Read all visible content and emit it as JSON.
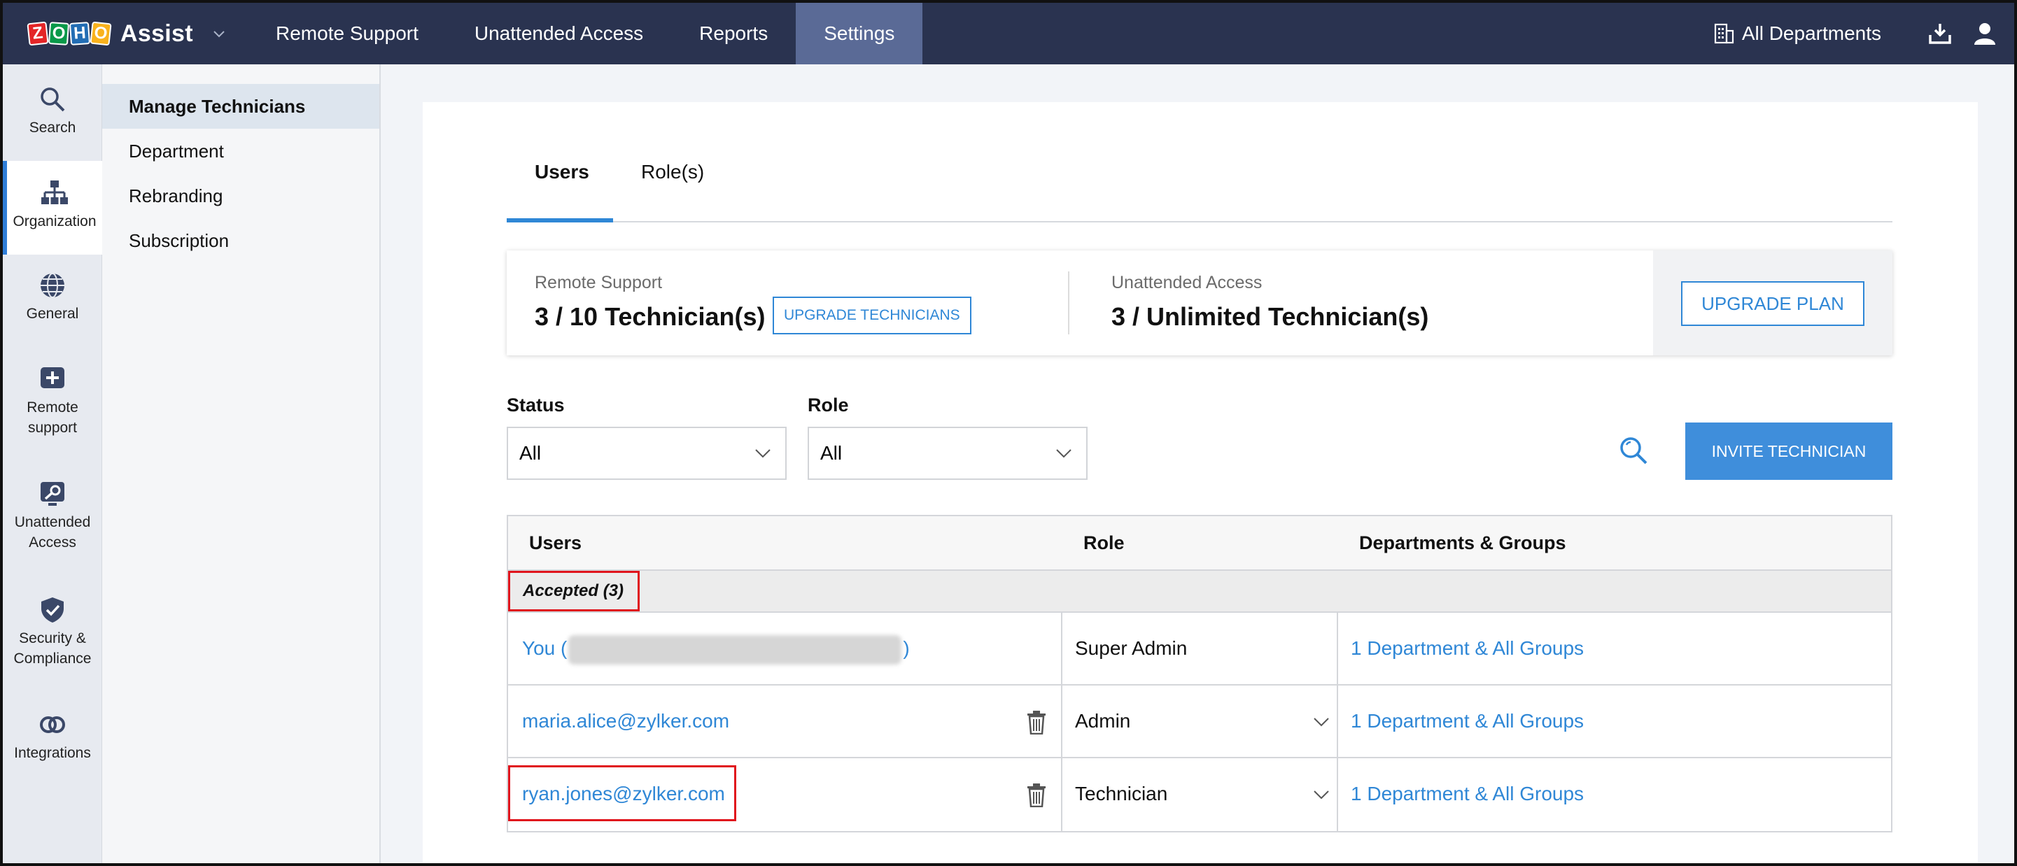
{
  "app": {
    "logo_letters": [
      "Z",
      "O",
      "H",
      "O"
    ],
    "logo_colors": [
      "#e42527",
      "#089949",
      "#226db4",
      "#f9b21d"
    ],
    "name": "Assist"
  },
  "topnav": {
    "items": [
      {
        "label": "Remote Support"
      },
      {
        "label": "Unattended Access"
      },
      {
        "label": "Reports"
      },
      {
        "label": "Settings",
        "active": true
      }
    ],
    "department": "All Departments"
  },
  "rail": {
    "items": [
      {
        "label": "Search",
        "icon": "search-icon"
      },
      {
        "label": "Organization",
        "icon": "organization-icon",
        "active": true
      },
      {
        "label": "General",
        "icon": "globe-icon"
      },
      {
        "label_line1": "Remote",
        "label_line2": "support",
        "icon": "plus-square-icon"
      },
      {
        "label_line1": "Unattended",
        "label_line2": "Access",
        "icon": "key-monitor-icon"
      },
      {
        "label_line1": "Security &",
        "label_line2": "Compliance",
        "icon": "shield-check-icon"
      },
      {
        "label": "Integrations",
        "icon": "link-icon"
      }
    ]
  },
  "subnav": {
    "items": [
      {
        "label": "Manage Technicians",
        "active": true
      },
      {
        "label": "Department"
      },
      {
        "label": "Rebranding"
      },
      {
        "label": "Subscription"
      }
    ]
  },
  "tabs": [
    {
      "label": "Users",
      "active": true
    },
    {
      "label": "Role(s)"
    }
  ],
  "plan": {
    "remote_support_label": "Remote Support",
    "remote_support_value": "3 / 10 Technician(s)",
    "upgrade_technicians": "UPGRADE TECHNICIANS",
    "unattended_label": "Unattended Access",
    "unattended_value": "3 / Unlimited Technician(s)",
    "upgrade_plan": "UPGRADE PLAN"
  },
  "filters": {
    "status_label": "Status",
    "status_value": "All",
    "role_label": "Role",
    "role_value": "All",
    "invite_button": "INVITE TECHNICIAN"
  },
  "table": {
    "headers": [
      "Users",
      "Role",
      "Departments & Groups"
    ],
    "group_label": "Accepted (3)",
    "rows": [
      {
        "user_prefix": "You (",
        "user_suffix": ")",
        "role": "Super Admin",
        "departments": "1 Department & All Groups"
      },
      {
        "user": "maria.alice@zylker.com",
        "role": "Admin",
        "departments": "1 Department & All Groups"
      },
      {
        "user": "ryan.jones@zylker.com",
        "role": "Technician",
        "departments": "1 Department & All Groups"
      }
    ]
  },
  "colors": {
    "topbar": "#2a3350",
    "accent": "#2f87d6",
    "highlight": "#e0141c"
  }
}
